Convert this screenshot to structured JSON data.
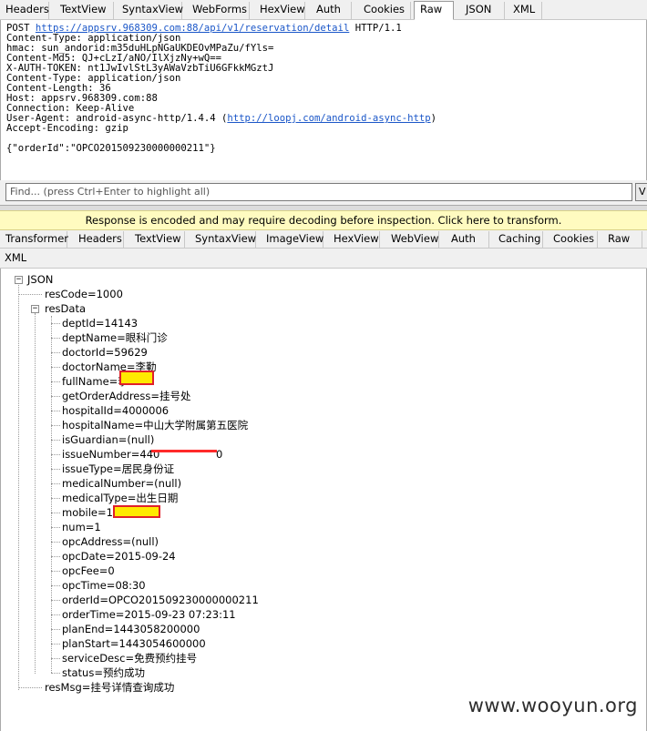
{
  "request_tabs": [
    "Headers",
    "TextView",
    "SyntaxView",
    "WebForms",
    "HexView",
    "Auth",
    "Cookies",
    "Raw",
    "JSON",
    "XML"
  ],
  "request_active_tab": "Raw",
  "raw_request": {
    "method": "POST",
    "url": "https://appsrv.968309.com:88/api/v1/reservation/detail",
    "protocol": "HTTP/1.1",
    "headers": [
      "Content-Type: application/json",
      "hmac: sun_andorid:m35duHLpNGaUKDEOvMPaZu/fYls=",
      "Content-Md5: QJ+cLzI/aNO/IlXjzNy+wQ==",
      "X-AUTH-TOKEN: nt1JwIvlStL3yAWaVzbTiU6GFkkMGztJ",
      "Content-Type: application/json",
      "Content-Length: 36",
      "Host: appsrv.968309.com:88",
      "Connection: Keep-Alive"
    ],
    "user_agent_prefix": "User-Agent: android-async-http/1.4.4 (",
    "user_agent_link": "http://loopj.com/android-async-http",
    "user_agent_suffix": ")",
    "accept_encoding": "Accept-Encoding: gzip",
    "body": "{\"orderId\":\"OPCO201509230000000211\"}"
  },
  "find": {
    "placeholder": "Find... (press Ctrl+Enter to highlight all)",
    "button_label": "V"
  },
  "notice": "Response is encoded and may require decoding before inspection. Click here to transform.",
  "response_tabs": [
    "Transformer",
    "Headers",
    "TextView",
    "SyntaxView",
    "ImageView",
    "HexView",
    "WebView",
    "Auth",
    "Caching",
    "Cookies",
    "Raw"
  ],
  "response_tabs_row2": [
    "XML"
  ],
  "tree": {
    "root": "JSON",
    "resCode": "resCode=1000",
    "resData": "resData",
    "items": [
      "deptId=14143",
      "deptName=眼科门诊",
      "doctorId=59629",
      "doctorName=李勤",
      "fullName=李",
      "getOrderAddress=挂号处",
      "hospitalId=4000006",
      "hospitalName=中山大学附属第五医院",
      "isGuardian=(null)",
      "issueNumber=440",
      "issueType=居民身份证",
      "medicalNumber=(null)",
      "medicalType=出生日期",
      "mobile=186",
      "num=1",
      "opcAddress=(null)",
      "opcDate=2015-09-24",
      "opcFee=0",
      "opcTime=08:30",
      "orderId=OPCO201509230000000211",
      "orderTime=2015-09-23 07:23:11",
      "planEnd=1443058200000",
      "planStart=1443054600000",
      "serviceDesc=免费预约挂号",
      "status=预约成功"
    ],
    "issueNumber_tail": "0",
    "resMsg": "resMsg=挂号详情查询成功"
  },
  "watermark": "www.wooyun.org"
}
